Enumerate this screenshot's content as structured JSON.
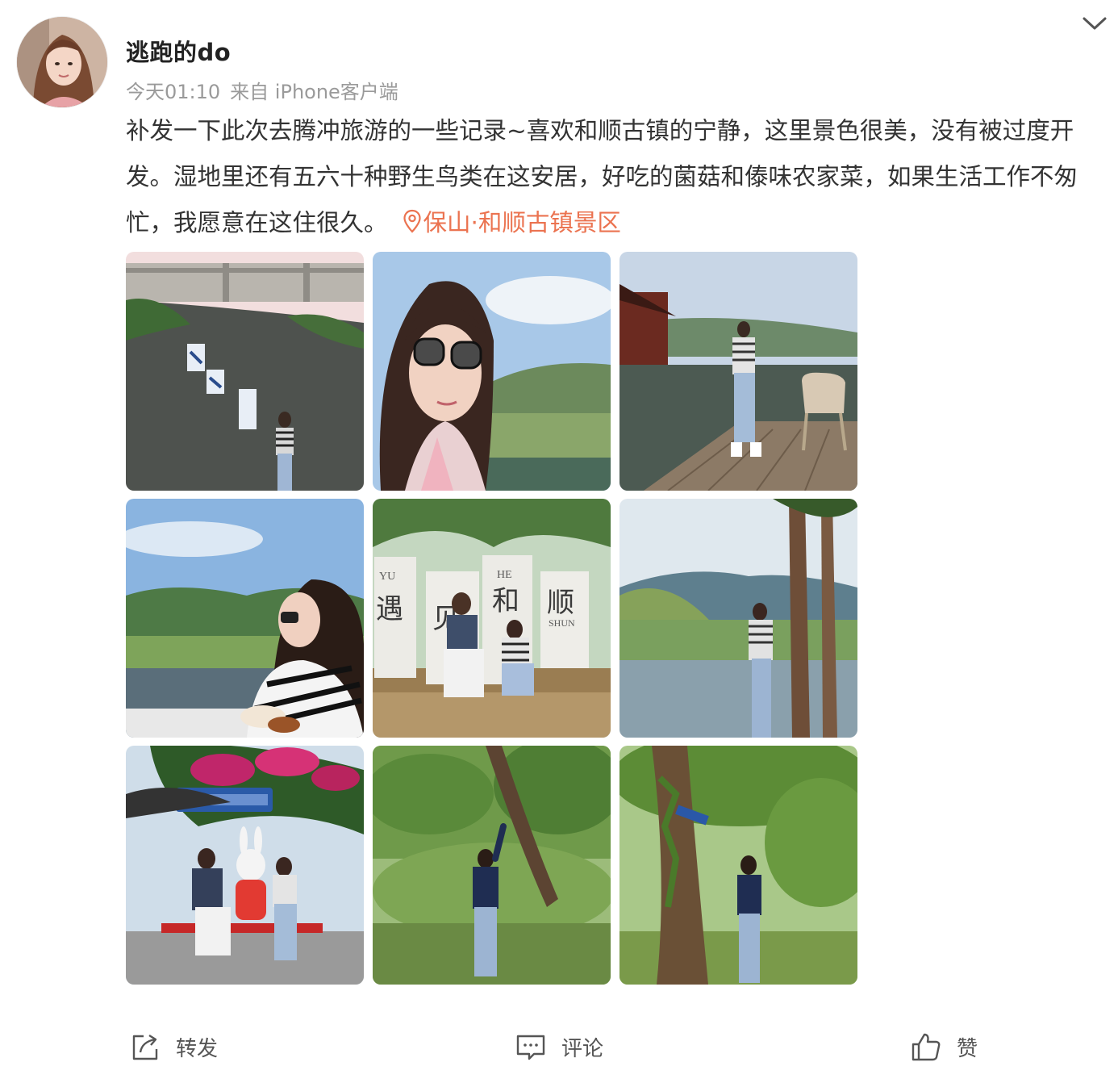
{
  "post": {
    "username": "逃跑的do",
    "time": "今天01:10",
    "source": "来自 iPhone客户端",
    "text": "补发一下此次去腾冲旅游的一些记录~喜欢和顺古镇的宁静，这里景色很美，没有被过度开发。湿地里还有五六十种野生鸟类在这安居，好吃的菌菇和傣味农家菜，如果生活工作不匆忙，我愿意在这住很久。",
    "location": "保山·和顺古镇景区",
    "avatar_icon": "user-avatar",
    "menu_icon": "chevron-down-icon"
  },
  "photos": [
    {
      "icon": "photo-stone-wall"
    },
    {
      "icon": "photo-selfie-glasses"
    },
    {
      "icon": "photo-wooden-pier"
    },
    {
      "icon": "photo-lakeside-snack"
    },
    {
      "icon": "photo-banner-couple"
    },
    {
      "icon": "photo-river-trees"
    },
    {
      "icon": "photo-cafe-rabbit"
    },
    {
      "icon": "photo-forest-pose"
    },
    {
      "icon": "photo-tree-path"
    }
  ],
  "banner_text": {
    "b1_pinyin": "YU",
    "b1_char": "遇",
    "b2_char": "见",
    "b3_pinyin": "HE",
    "b3_char": "和",
    "b4_char": "顺",
    "b4_pinyin": "SHUN"
  },
  "toolbar": {
    "repost_label": "转发",
    "comment_label": "评论",
    "like_label": "赞",
    "repost_icon": "share-icon",
    "comment_icon": "comment-icon",
    "like_icon": "thumbs-up-icon"
  },
  "colors": {
    "location": "#eb7350",
    "meta": "#9a9a9a",
    "text": "#333333"
  }
}
